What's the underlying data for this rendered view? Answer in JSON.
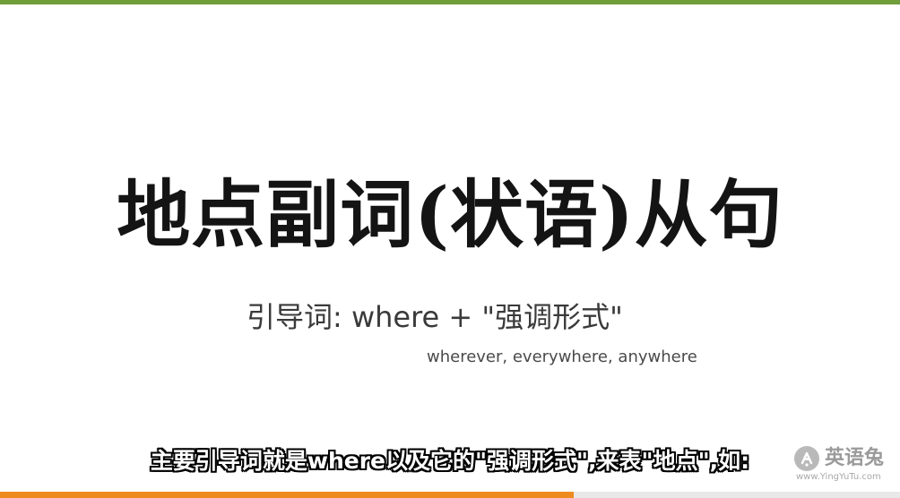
{
  "slide": {
    "title": "地点副词(状语)从句",
    "subtitle": "引导词: where + \"强调形式\"",
    "variants": "wherever, everywhere, anywhere"
  },
  "subtitle_caption": "主要引导词就是where以及它的\"强调形式\",来表\"地点\",如:",
  "watermark": {
    "name": "英语兔",
    "url": "www.YingYuTu.com",
    "icon": "rabbit-logo-icon"
  },
  "colors": {
    "top_bar": "#6f9e3b",
    "bottom_bar_left": "#ef8a1f",
    "bottom_bar_right": "#e8e8e8",
    "title": "#141414",
    "caption_fill": "#ffffff",
    "caption_outline": "#000000"
  }
}
